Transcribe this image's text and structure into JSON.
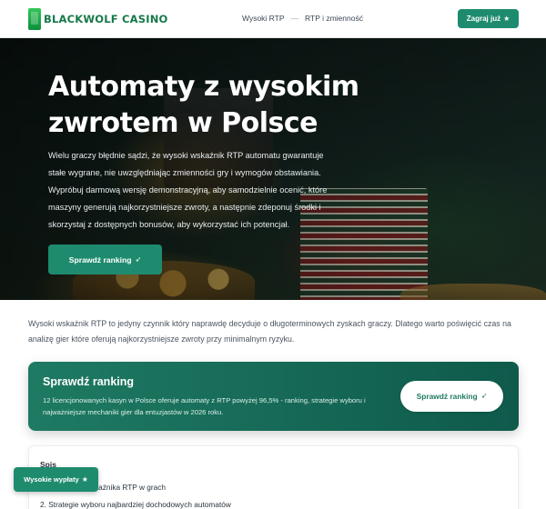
{
  "header": {
    "logo_text": "BLACKWOLF CASINO",
    "nav": [
      {
        "label": "Wysoki RTP"
      },
      {
        "label": "RTP i zmienność"
      }
    ],
    "nav_separator": "—",
    "cta_label": "Zagraj już",
    "cta_icon": "star-icon"
  },
  "hero": {
    "title": "Automaty z wysokim zwrotem w Polsce",
    "text": "Wielu graczy błędnie sądzi, że wysoki wskaźnik RTP automatu gwarantuje stałe wygrane, nie uwzględniając zmienności gry i wymogów obstawiania. Wypróbuj darmową wersję demonstracyjną, aby samodzielnie ocenić, które maszyny generują najkorzystniejsze zwroty, a następnie zdeponuj środki i skorzystaj z dostępnych bonusów, aby wykorzystać ich potencjał.",
    "cta_label": "Sprawdź ranking",
    "cta_icon": "rocket-icon"
  },
  "intro": {
    "text": "Wysoki wskaźnik RTP to jedyny czynnik który naprawdę decyduje o długoterminowych zyskach graczy. Dlatego warto poświęcić czas na analizę gier które oferują najkorzystniejsze zwroty przy minimalnym ryzyku."
  },
  "cta_box": {
    "title": "Sprawdź ranking",
    "text": "12 licencjonowanych kasyn w Polsce oferuje automaty z RTP powyżej 96,5% - ranking, strategie wyboru i najważniejsze mechaniki gier dla entuzjastów w 2026 roku.",
    "button_label": "Sprawdź ranking",
    "button_icon": "rocket-icon"
  },
  "toc": {
    "title": "Spis",
    "items": [
      {
        "label": "1. Znaczenie wskaźnika RTP w grach"
      },
      {
        "label": "2. Strategie wyboru najbardziej dochodowych automatów"
      }
    ]
  },
  "floating": {
    "label": "Wysokie wypłaty",
    "icon": "star-icon"
  },
  "colors": {
    "accent": "#1e8b6f",
    "logo": "#17794a",
    "cta_box": "#1e7a63"
  }
}
